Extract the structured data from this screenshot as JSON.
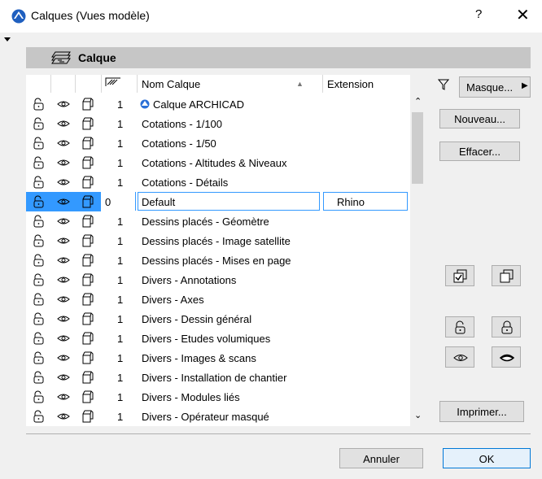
{
  "window": {
    "title": "Calques (Vues modèle)",
    "help_label": "?",
    "close_label": "✕"
  },
  "section": {
    "label": "Calque"
  },
  "list": {
    "columns": {
      "name": "Nom Calque",
      "extension": "Extension"
    },
    "rows": [
      {
        "level": "1",
        "name": "Calque ARCHICAD",
        "ext": "",
        "archicad": true
      },
      {
        "level": "1",
        "name": "Cotations - 1/100",
        "ext": ""
      },
      {
        "level": "1",
        "name": "Cotations - 1/50",
        "ext": ""
      },
      {
        "level": "1",
        "name": "Cotations - Altitudes & Niveaux",
        "ext": ""
      },
      {
        "level": "1",
        "name": "Cotations - Détails",
        "ext": ""
      },
      {
        "level": "0",
        "name": "Default",
        "ext": "Rhino",
        "selected": true
      },
      {
        "level": "1",
        "name": "Dessins placés - Géomètre",
        "ext": ""
      },
      {
        "level": "1",
        "name": "Dessins placés - Image satellite",
        "ext": ""
      },
      {
        "level": "1",
        "name": "Dessins placés - Mises en page",
        "ext": ""
      },
      {
        "level": "1",
        "name": "Divers - Annotations",
        "ext": ""
      },
      {
        "level": "1",
        "name": "Divers - Axes",
        "ext": ""
      },
      {
        "level": "1",
        "name": "Divers - Dessin général",
        "ext": ""
      },
      {
        "level": "1",
        "name": "Divers - Etudes volumiques",
        "ext": ""
      },
      {
        "level": "1",
        "name": "Divers - Images & scans",
        "ext": ""
      },
      {
        "level": "1",
        "name": "Divers - Installation de chantier",
        "ext": ""
      },
      {
        "level": "1",
        "name": "Divers - Modules liés",
        "ext": ""
      },
      {
        "level": "1",
        "name": "Divers - Opérateur masqué",
        "ext": ""
      }
    ]
  },
  "buttons": {
    "masque": "Masque...",
    "nouveau": "Nouveau...",
    "effacer": "Effacer...",
    "imprimer": "Imprimer...",
    "annuler": "Annuler",
    "ok": "OK"
  },
  "icons": {
    "row_icons": [
      "padlock-open-icon",
      "eye-icon",
      "wireframe-icon"
    ],
    "section": "layer-stack-icon",
    "filter": "filter-icon"
  },
  "colors": {
    "selection": "#3399ff",
    "header_bg": "#c6c6c6",
    "archicad_blue": "#2a6fd6"
  }
}
